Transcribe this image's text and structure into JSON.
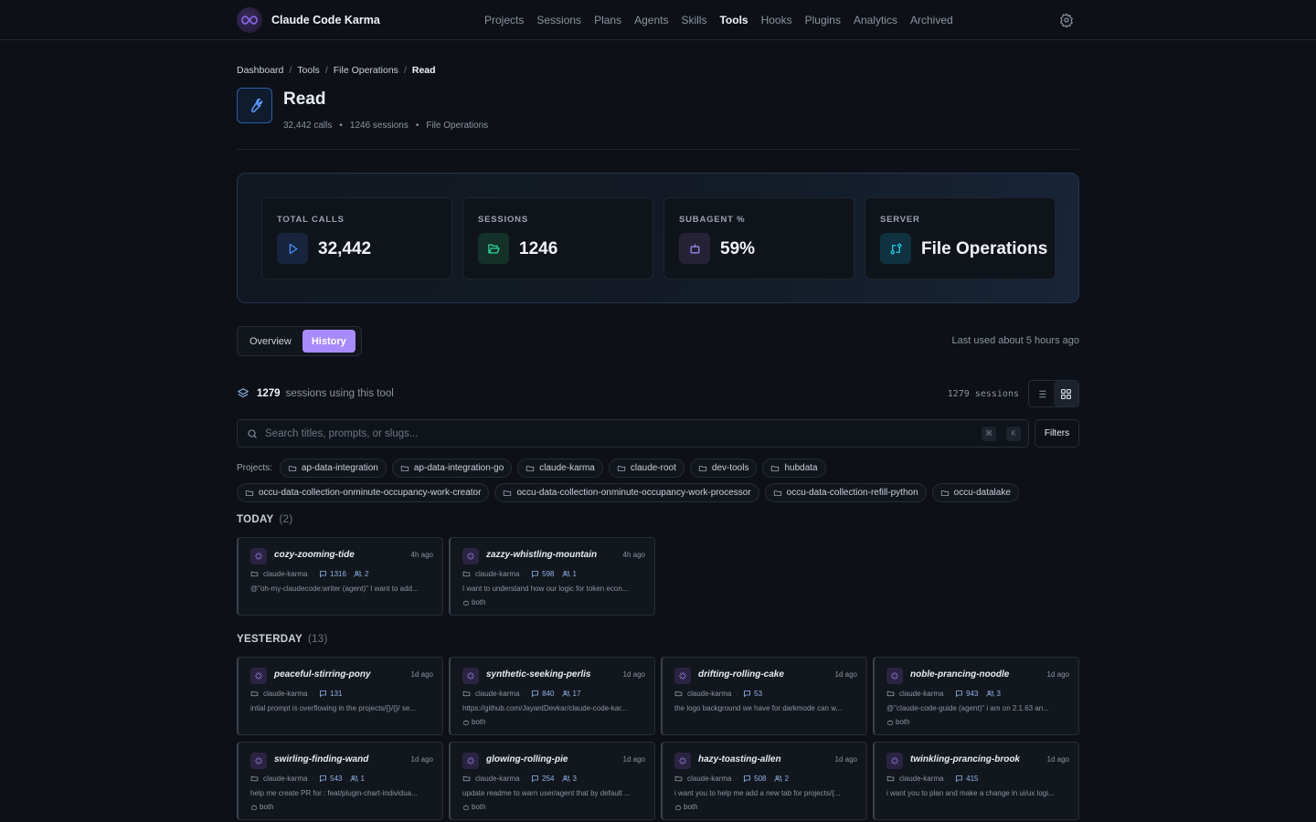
{
  "app": {
    "name": "Claude Code Karma"
  },
  "nav": [
    {
      "label": "Projects"
    },
    {
      "label": "Sessions"
    },
    {
      "label": "Plans"
    },
    {
      "label": "Agents"
    },
    {
      "label": "Skills"
    },
    {
      "label": "Tools",
      "active": true
    },
    {
      "label": "Hooks"
    },
    {
      "label": "Plugins"
    },
    {
      "label": "Analytics"
    },
    {
      "label": "Archived"
    }
  ],
  "breadcrumb": [
    "Dashboard",
    "Tools",
    "File Operations",
    "Read"
  ],
  "tool": {
    "title": "Read",
    "calls": "32,442 calls",
    "sessions": "1246 sessions",
    "category": "File Operations",
    "dot": "•"
  },
  "stats": [
    {
      "label": "TOTAL CALLS",
      "value": "32,442",
      "icon": "play-icon",
      "color": "#4b8dff"
    },
    {
      "label": "SESSIONS",
      "value": "1246",
      "icon": "folder-open-icon",
      "color": "#34d399"
    },
    {
      "label": "SUBAGENT %",
      "value": "59%",
      "icon": "robot-icon",
      "color": "#a78bfa"
    },
    {
      "label": "SERVER",
      "value": "File Operations",
      "icon": "git-compare-icon",
      "color": "#22d3ee"
    }
  ],
  "tabs": [
    {
      "label": "Overview"
    },
    {
      "label": "History",
      "active": true
    }
  ],
  "last_used": "Last used about 5 hours ago",
  "sessions_summary": {
    "count": "1279",
    "label": "sessions using this tool",
    "right": "1279 sessions"
  },
  "search": {
    "placeholder": "Search titles, prompts, or slugs...",
    "kbd1": "⌘",
    "kbd2": "K"
  },
  "filters_label": "Filters",
  "projects_label": "Projects:",
  "projects_row1": [
    "ap-data-integration",
    "ap-data-integration-go",
    "claude-karma",
    "claude-root",
    "dev-tools",
    "hubdata"
  ],
  "projects_row2": [
    "occu-data-collection-onminute-occupancy-work-creator",
    "occu-data-collection-onminute-occupancy-work-processor",
    "occu-data-collection-refill-python",
    "occu-datalake"
  ],
  "groups": {
    "today": {
      "title": "TODAY",
      "count": "(2)"
    },
    "yesterday": {
      "title": "YESTERDAY",
      "count": "(13)"
    }
  },
  "cards": [
    {
      "title": "cozy-zooming-tide",
      "time": "4h ago",
      "project": "claude-karma",
      "messages": "1316",
      "agents": "2",
      "desc": "@\"oh-my-claudecode:writer (agent)\" I want to add...",
      "both": ""
    },
    {
      "title": "zazzy-whistling-mountain",
      "time": "4h ago",
      "project": "claude-karma",
      "messages": "598",
      "agents": "1",
      "desc": "I want to understand how our logic for token econ...",
      "both": "both"
    },
    {
      "title": "peaceful-stirring-pony",
      "time": "1d ago",
      "project": "claude-karma",
      "messages": "131",
      "agents": "",
      "desc": "intial prompt is overflowing in the projects/{}/{}/ se...",
      "both": ""
    },
    {
      "title": "synthetic-seeking-perlis",
      "time": "1d ago",
      "project": "claude-karma",
      "messages": "840",
      "agents": "17",
      "desc": "https://github.com/JayantDevkar/claude-code-kar...",
      "both": "both"
    },
    {
      "title": "drifting-rolling-cake",
      "time": "1d ago",
      "project": "claude-karma",
      "messages": "53",
      "agents": "",
      "desc": "the logo background we have for darkmode can w...",
      "both": ""
    },
    {
      "title": "noble-prancing-noodle",
      "time": "1d ago",
      "project": "claude-karma",
      "messages": "943",
      "agents": "3",
      "desc": "@\"claude-code-guide (agent)\" i am on 2.1.63 an...",
      "both": "both"
    },
    {
      "title": "swirling-finding-wand",
      "time": "1d ago",
      "project": "claude-karma",
      "messages": "543",
      "agents": "1",
      "desc": "help me create PR for : feat/plugin-chart-individua...",
      "both": "both"
    },
    {
      "title": "glowing-rolling-pie",
      "time": "1d ago",
      "project": "claude-karma",
      "messages": "254",
      "agents": "3",
      "desc": "update readme to warn user/agent that by default ...",
      "both": "both"
    },
    {
      "title": "hazy-toasting-allen",
      "time": "1d ago",
      "project": "claude-karma",
      "messages": "508",
      "agents": "2",
      "desc": "i want you to help me add a new tab for projects/{...",
      "both": "both"
    },
    {
      "title": "twinkling-prancing-brook",
      "time": "1d ago",
      "project": "claude-karma",
      "messages": "415",
      "agents": "",
      "desc": "i want you to plan and make a change in ui/ux logi...",
      "both": ""
    }
  ]
}
